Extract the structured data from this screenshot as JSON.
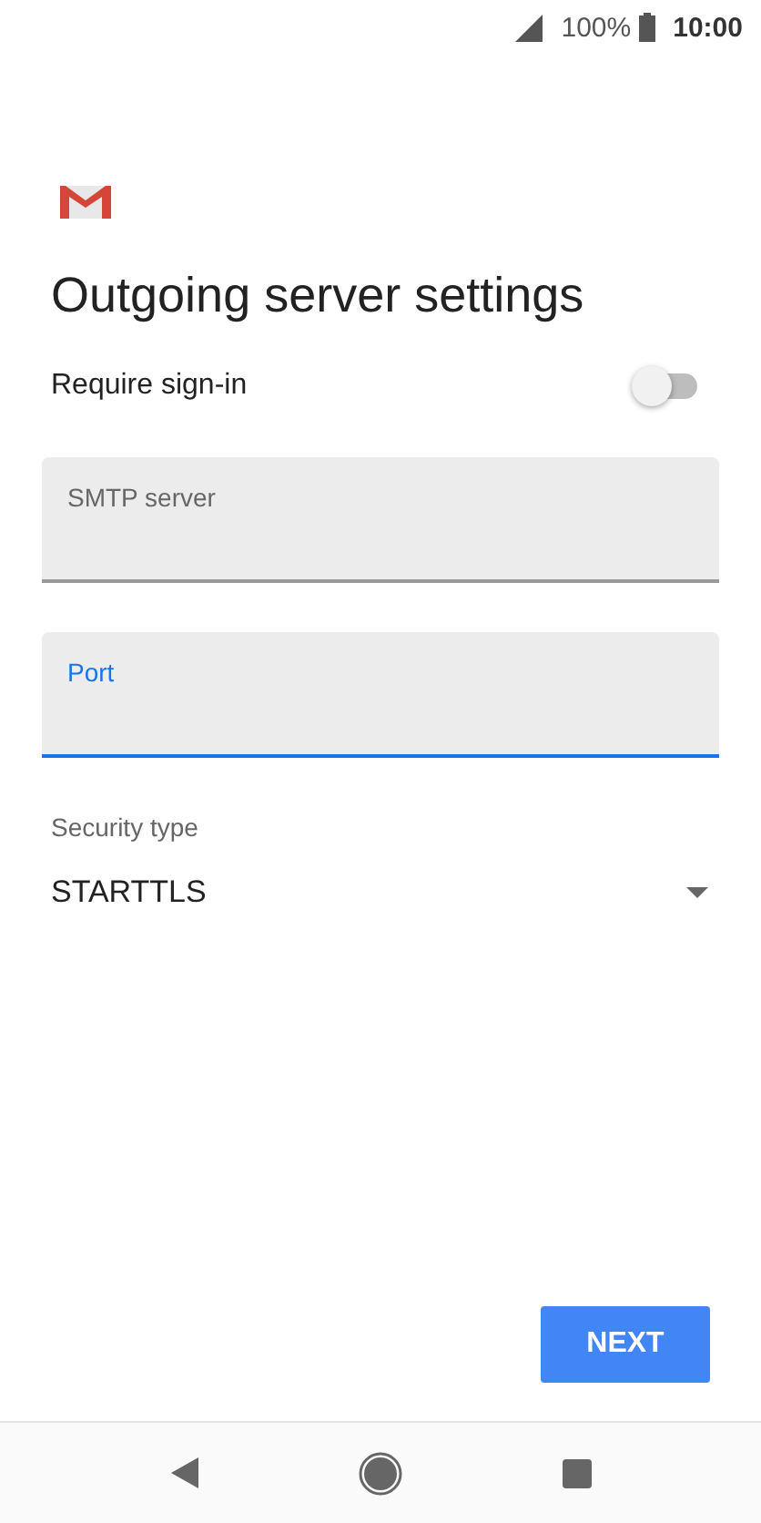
{
  "status_bar": {
    "battery": "100%",
    "time": "10:00"
  },
  "title": "Outgoing server settings",
  "require_sign_in": {
    "label": "Require sign-in",
    "on": false
  },
  "fields": [
    {
      "label": "SMTP server",
      "focused": false
    },
    {
      "label": "Port",
      "focused": true
    }
  ],
  "security_type": {
    "label": "Security type",
    "value": "STARTTLS"
  },
  "next_button": "NEXT"
}
